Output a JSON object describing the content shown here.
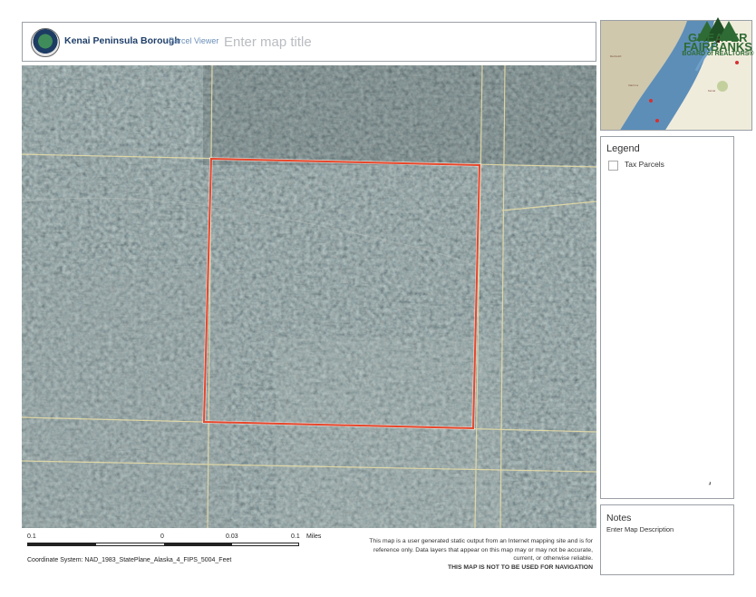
{
  "header": {
    "brand": "Kenai Peninsula Borough",
    "brand_sub": "Parcel Viewer",
    "map_title_placeholder": "Enter map title"
  },
  "legend": {
    "title": "Legend",
    "items": [
      {
        "label": "Tax Parcels",
        "checked": false
      }
    ],
    "tick": "⸥"
  },
  "notes": {
    "title": "Notes",
    "description": "Enter Map Description"
  },
  "scale": {
    "labels": [
      "0.1",
      "0",
      "0.03",
      "0.1"
    ],
    "unit": "Miles"
  },
  "coordinate_system": "Coordinate System:   NAD_1983_StatePlane_Alaska_4_FIPS_5004_Feet",
  "disclaimer": {
    "lines": [
      "This map is a user generated static output from an Internet mapping site and is for",
      "reference only. Data layers that appear on this map may or may not be accurate,",
      "current, or otherwise reliable."
    ],
    "warning": "THIS MAP IS NOT TO BE USED FOR NAVIGATION"
  },
  "logo": {
    "line1": "GREATER",
    "line2": "FAIRBANKS",
    "line3": "BOARD of REALTORS®"
  },
  "watermark": "",
  "colors": {
    "parcel_outline": "#e8462a",
    "parcel_lines": "#e6dca6",
    "forest_base": "#4a5a57",
    "brand_blue": "#1f3f6a",
    "logo_green": "#2f6b34"
  }
}
